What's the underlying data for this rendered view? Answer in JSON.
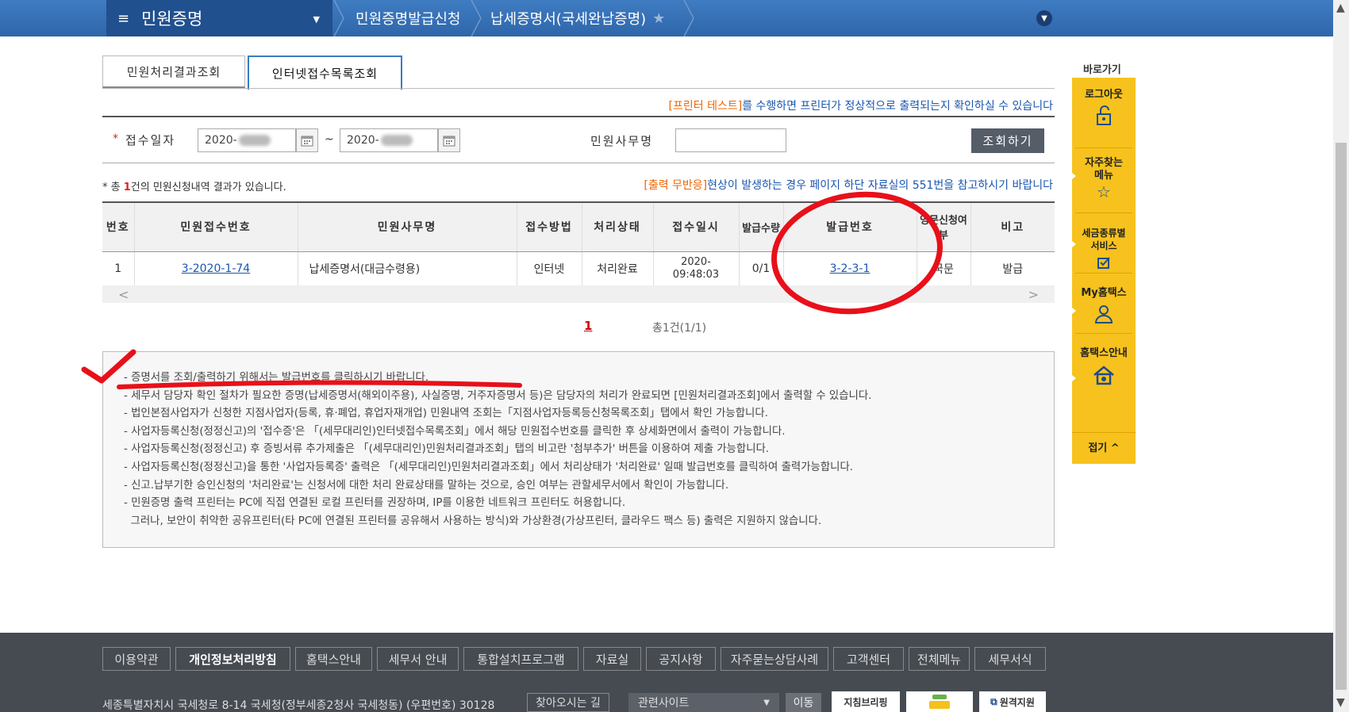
{
  "header": {
    "menu_title": "민원증명",
    "breadcrumb_1": "민원증명발급신청",
    "breadcrumb_2": "납세증명서(국세완납증명)"
  },
  "tabs": [
    {
      "label": "민원처리결과조회",
      "active": false
    },
    {
      "label": "인터넷접수목록조회",
      "active": true
    }
  ],
  "printer_notice": {
    "highlight": "[프린터 테스트]",
    "text": "를 수행하면 프린터가 정상적으로 출력되는지 확인하실 수 있습니다"
  },
  "search": {
    "date_label": "접수일자",
    "date_from": "2020-",
    "date_to": "2020-",
    "tilde": "~",
    "name_label": "민원사무명",
    "name_value": "",
    "button": "조회하기"
  },
  "result": {
    "prefix": "* 총 ",
    "count": "1",
    "suffix": "건의 민원신청내역 결과가 있습니다."
  },
  "noresp_notice": {
    "highlight": "[출력 무반응]",
    "text": "현상이 발생하는 경우 페이지 하단 자료실의 551번을 참고하시기 바랍니다"
  },
  "table": {
    "headers": [
      "번호",
      "민원접수번호",
      "민원사무명",
      "접수방법",
      "처리상태",
      "접수일시",
      "발급수량",
      "발급번호",
      "영문신청여부",
      "비고"
    ],
    "rows": [
      {
        "no": "1",
        "receipt_no": "3-2020-1-74",
        "name": "납세증명서(대금수령용)",
        "method": "인터넷",
        "status": "처리완료",
        "date": "2020-",
        "time": "09:48:03",
        "qty": "0/1",
        "issue_no": "3-2-3-1",
        "english": "국문",
        "note": "발급"
      }
    ]
  },
  "pagination": {
    "current": "1",
    "total": "총1건(1/1)"
  },
  "notes": [
    "- 증명서를 조회/출력하기 위해서는 발급번호를 클릭하시기 바랍니다.",
    "- 세무서 담당자 확인 절차가 필요한 증명(납세증명서(해외이주용), 사실증명, 거주자증명서 등)은 담당자의 처리가 완료되면 [민원처리결과조회]에서 출력할 수 있습니다.",
    "- 법인본점사업자가 신청한 지점사업자(등록, 휴·폐업, 휴업자재개업) 민원내역 조회는「지점사업자등록등신청목록조회」탭에서 확인 가능합니다.",
    "- 사업자등록신청(정정신고)의 '접수증'은 「(세무대리인)인터넷접수목록조회」에서 해당 민원접수번호를 클릭한 후 상세화면에서 출력이 가능합니다.",
    "- 사업자등록신청(정정신고) 후 증빙서류 추가제출은 「(세무대리인)민원처리결과조회」탭의 비고란 '첨부추가' 버튼을 이용하여 제출 가능합니다.",
    "- 사업자등록신청(정정신고)을 통한 '사업자등록증' 출력은 「(세무대리인)민원처리결과조회」에서 처리상태가 '처리완료' 일때 발급번호를 클릭하여 출력가능합니다.",
    "- 신고.납부기한 승인신청의 '처리완료'는 신청서에 대한 처리 완료상태를 말하는 것으로, 승인 여부는 관할세무서에서 확인이 가능합니다.",
    "- 민원증명 출력 프린터는 PC에 직접 연결된 로컬 프린터를 권장하며, IP를 이용한 네트워크 프린터도 허용합니다.",
    "  그러나, 보안이 취약한 공유프린터(타 PC에 연결된 프린터를 공유해서 사용하는 방식)와 가상환경(가상프린터, 클라우드 팩스 등) 출력은 지원하지 않습니다."
  ],
  "quick_menu": {
    "title": "바로가기",
    "items": [
      "로그아웃",
      "자주찾는 메뉴",
      "세금종류별 서비스",
      "My홈택스",
      "홈택스안내"
    ],
    "fold": "접기"
  },
  "footer": {
    "links": [
      "이용약관",
      "개인정보처리방침",
      "홈택스안내",
      "세무서 안내",
      "통합설치프로그램",
      "자료실",
      "공지사항",
      "자주묻는상담사례",
      "고객센터",
      "전체메뉴",
      "세무서식"
    ],
    "address": "세종특별자치시 국세청로 8-14 국세청(정부세종2청사 국세청동) (우편번호) 30128",
    "find_way": "찾아오시는 길",
    "related_sites": "관련사이트",
    "move": "이동",
    "banner_1": "지침브리핑",
    "banner_3": "원격지원"
  },
  "colors": {
    "nav_blue": "#2f66aa",
    "quick_yellow": "#f7c21d",
    "annotation_red": "#e8101a",
    "link_blue": "#1a56b0"
  }
}
